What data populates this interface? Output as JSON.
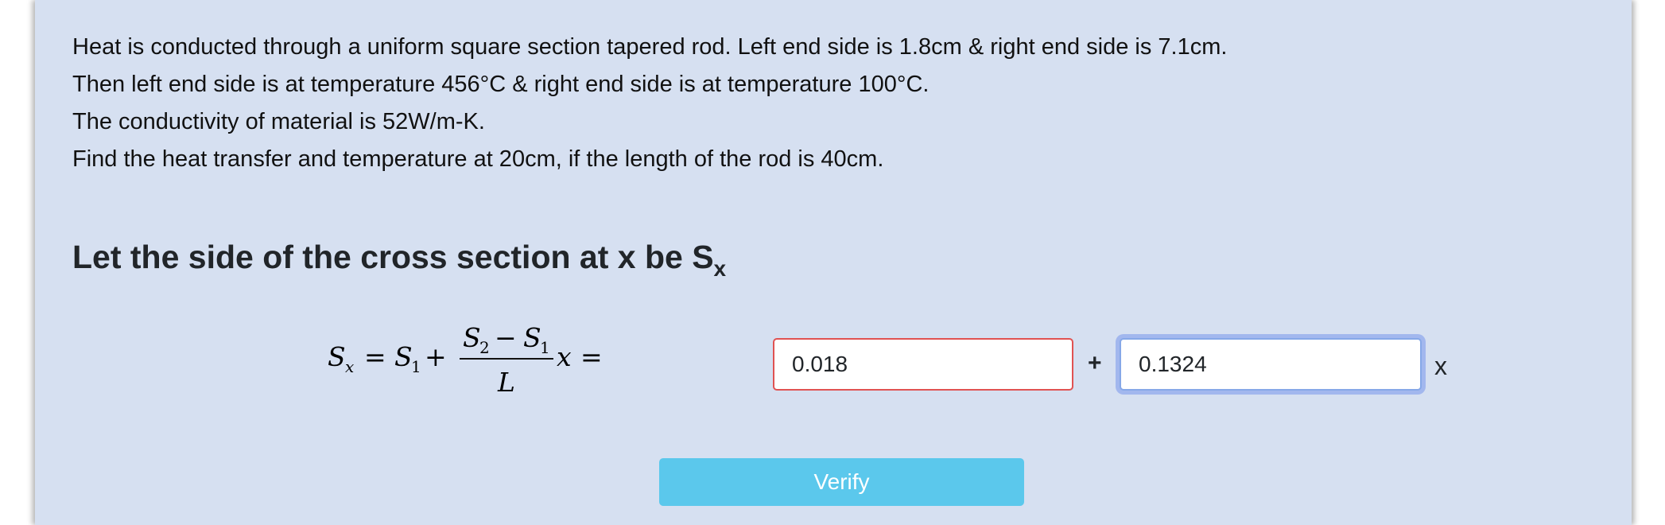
{
  "problem": {
    "line1": "Heat is conducted through a uniform square section tapered rod. Left end side is 1.8cm & right end side is 7.1cm.",
    "line2": "Then left end side is at temperature 456°C & right end side is at temperature 100°C.",
    "line3": "The conductivity of material is 52W/m-K.",
    "line4": "Find the heat transfer and temperature at 20cm, if the length of the rod is 40cm."
  },
  "section": {
    "heading": "Let the side of the cross section at x be S",
    "heading_sub": "x"
  },
  "formula": {
    "lhs": "S",
    "lhs_sub": "x",
    "eq": "=",
    "s1": "S",
    "s1_sub": "1",
    "plus": "+",
    "num_a": "S",
    "num_a_sub": "2",
    "minus": "−",
    "num_b": "S",
    "num_b_sub": "1",
    "den": "L",
    "var": "x",
    "eq2": "="
  },
  "inputs": {
    "first_value": "0.018",
    "second_value": "0.1324"
  },
  "operators": {
    "plus": "+",
    "x": "x"
  },
  "verify_button": {
    "label": "Verify"
  },
  "colors": {
    "panel_bg": "#d6e0f1",
    "error_border": "#e05252",
    "focus_border": "#86a8e8",
    "button_bg": "#5bc8ec"
  }
}
